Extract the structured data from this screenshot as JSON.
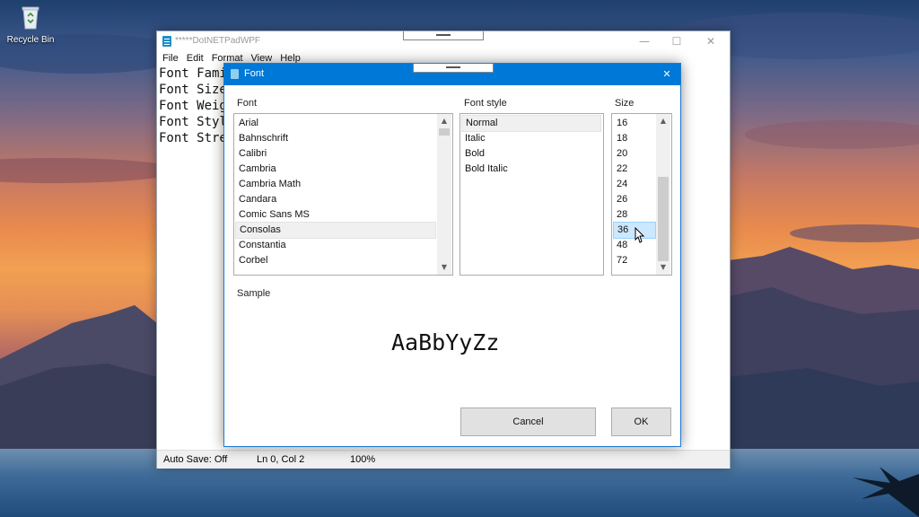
{
  "desktop": {
    "recycle_bin_label": "Recycle Bin"
  },
  "main_window": {
    "title": "*****DotNETPadWPF",
    "caption_buttons": {
      "minimize": "—",
      "maximize": "☐",
      "close": "✕"
    },
    "menu": [
      "File",
      "Edit",
      "Format",
      "View",
      "Help"
    ],
    "editor_lines": [
      "Font Family",
      "Font Size",
      "Font Weight",
      "Font Style",
      "Font Stretch"
    ],
    "status": {
      "autosave": "Auto Save: Off",
      "position": "Ln 0, Col 2",
      "zoom": "100%"
    }
  },
  "font_dialog": {
    "title": "Font",
    "close_glyph": "✕",
    "font_label": "Font",
    "style_label": "Font style",
    "size_label": "Size",
    "fonts": [
      "Arial",
      "Bahnschrift",
      "Calibri",
      "Cambria",
      "Cambria Math",
      "Candara",
      "Comic Sans MS",
      "Consolas",
      "Constantia",
      "Corbel"
    ],
    "selected_font": "Consolas",
    "styles": [
      "Normal",
      "Italic",
      "Bold",
      "Bold Italic"
    ],
    "selected_style": "Normal",
    "sizes": [
      "16",
      "18",
      "20",
      "22",
      "24",
      "26",
      "28",
      "36",
      "48",
      "72"
    ],
    "selected_size": "36",
    "sample_label": "Sample",
    "sample_text": "AaBbYyZz",
    "cancel_label": "Cancel",
    "ok_label": "OK"
  },
  "icons": {
    "recycle_bin": "recycle-bin-icon",
    "app": "notepad-app-icon",
    "scroll_up": "▲",
    "scroll_down": "▼",
    "cursor": "mouse-pointer-icon"
  },
  "colors": {
    "dialog_titlebar": "#0078d7",
    "selection_highlight": "#cce8ff",
    "button_face": "#e1e1e1"
  }
}
